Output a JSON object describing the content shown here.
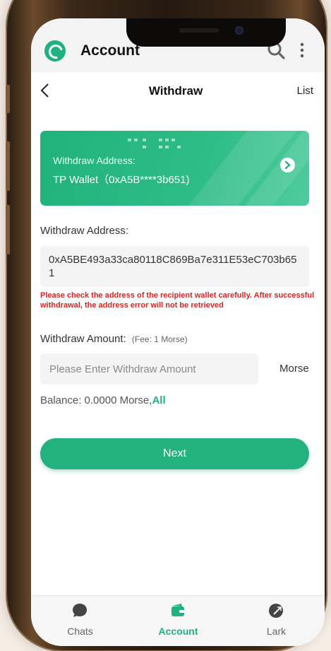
{
  "header": {
    "title": "Account",
    "search_icon": "search-icon",
    "more_icon": "more-vertical-icon"
  },
  "nav": {
    "title": "Withdraw",
    "list_label": "List"
  },
  "card": {
    "label": "Withdraw Address:",
    "wallet": "TP Wallet（0xA5B****3b651)"
  },
  "form": {
    "address_label": "Withdraw Address:",
    "address_value": "0xA5BE493a33ca80118C869Ba7e311E53eC703b651",
    "warning": "Please check the address of the recipient wallet carefully. After successful withdrawal, the address error will not be retrieved",
    "amount_label": "Withdraw Amount:",
    "fee": "(Fee:  1 Morse)",
    "amount_placeholder": "Please Enter Withdraw Amount",
    "amount_unit": "Morse",
    "balance_text": "Balance:  0.0000 Morse,",
    "all_label": "All",
    "next_label": "Next"
  },
  "tabs": [
    {
      "label": "Chats",
      "icon": "chat-bubble-icon"
    },
    {
      "label": "Account",
      "icon": "wallet-icon"
    },
    {
      "label": "Lark",
      "icon": "lark-icon"
    }
  ],
  "colors": {
    "accent": "#1fb27e",
    "warning": "#e0201c"
  }
}
